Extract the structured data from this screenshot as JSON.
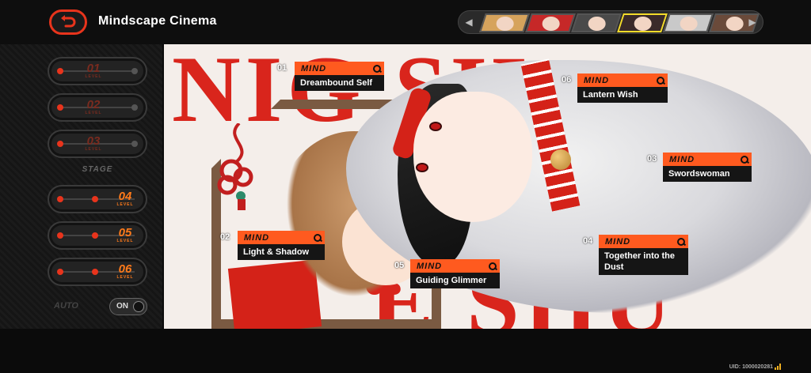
{
  "header": {
    "title": "Mindscape Cinema"
  },
  "character_selector": {
    "characters": [
      {
        "name": "character-1",
        "color": "#d6a35c"
      },
      {
        "name": "character-2",
        "color": "#c62828"
      },
      {
        "name": "character-3",
        "color": "#4a4a4a"
      },
      {
        "name": "character-4",
        "color": "#3a2a2a",
        "selected": true
      },
      {
        "name": "character-5",
        "color": "#c9c9c9"
      },
      {
        "name": "character-6",
        "color": "#6a4a3a"
      }
    ]
  },
  "levels": [
    {
      "number": "01",
      "label": "LEVEL",
      "state": "locked"
    },
    {
      "number": "02",
      "label": "LEVEL",
      "state": "locked"
    },
    {
      "number": "03",
      "label": "LEVEL",
      "state": "locked"
    },
    {
      "number": "04",
      "label": "LEVEL",
      "state": "unlocked"
    },
    {
      "number": "05",
      "label": "LEVEL",
      "state": "unlocked"
    },
    {
      "number": "06",
      "label": "LEVEL",
      "state": "unlocked"
    }
  ],
  "stage_label": "STAGE",
  "auto_toggle": {
    "label": "AUTO",
    "state": "ON"
  },
  "artwork": {
    "letters_top": "NIG SH",
    "letters_bottom": "E SHU",
    "quote": "“"
  },
  "mind_tags": [
    {
      "num": "01",
      "word": "MIND",
      "title": "Dreambound Self"
    },
    {
      "num": "02",
      "word": "MIND",
      "title": "Light & Shadow"
    },
    {
      "num": "03",
      "word": "MIND",
      "title": "Swordswoman"
    },
    {
      "num": "04",
      "word": "MIND",
      "title": "Together into the Dust"
    },
    {
      "num": "05",
      "word": "MIND",
      "title": "Guiding Glimmer"
    },
    {
      "num": "06",
      "word": "MIND",
      "title": "Lantern Wish"
    }
  ],
  "footer": {
    "uid": "UID: 1000020281"
  },
  "colors": {
    "accent": "#ff5a1f",
    "red": "#e8341c",
    "selected_border": "#f4dc2a"
  }
}
